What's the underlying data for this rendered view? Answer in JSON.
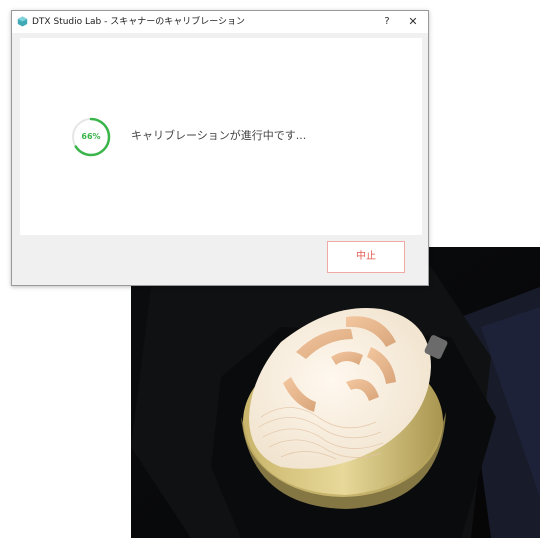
{
  "dialog": {
    "title": "DTX Studio Lab - スキャナーのキャリブレーション",
    "help_label": "?",
    "close_label": "✕",
    "icons": {
      "app": "app-logo-icon"
    }
  },
  "progress": {
    "percent_label": "66%",
    "value": 0.66,
    "status_text": "キャリブレーションが進行中です..."
  },
  "actions": {
    "stop_label": "中止"
  },
  "colors": {
    "progress_green": "#3ab54a",
    "stop_red": "#e25b50"
  }
}
